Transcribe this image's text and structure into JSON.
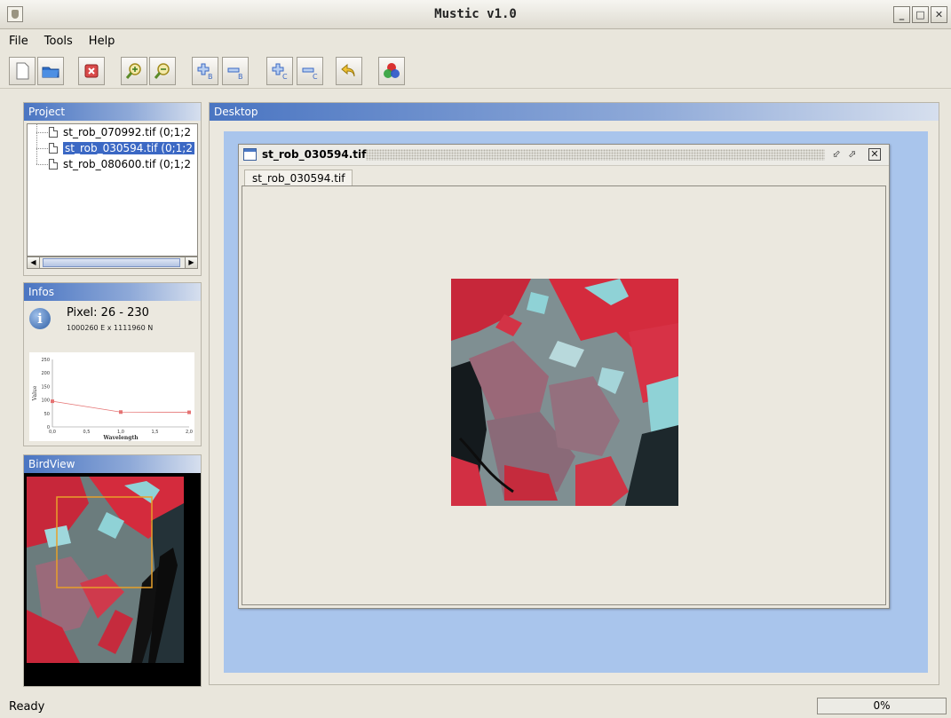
{
  "window": {
    "title": "Mustic v1.0"
  },
  "menu": [
    "File",
    "Tools",
    "Help"
  ],
  "toolbar": {
    "buttons": [
      "new-file",
      "open-folder",
      "close-file",
      "zoom-in",
      "zoom-out",
      "add-band",
      "remove-band",
      "add-class",
      "remove-class",
      "undo",
      "rgb-composite"
    ]
  },
  "project": {
    "title": "Project",
    "files": [
      {
        "label": "st_rob_070992.tif (0;1;2",
        "selected": false
      },
      {
        "label": "st_rob_030594.tif (0;1;2",
        "selected": true
      },
      {
        "label": "st_rob_080600.tif (0;1;2",
        "selected": false
      }
    ]
  },
  "infos": {
    "title": "Infos",
    "pixel": "Pixel: 26 - 230",
    "coords": "1000260 E x 1111960 N"
  },
  "chart_data": {
    "type": "line",
    "x": [
      0.0,
      1.0,
      2.0
    ],
    "values": [
      95,
      55,
      54
    ],
    "xlabel": "Wavelength",
    "ylabel": "Value",
    "xlim": [
      0.0,
      2.0
    ],
    "ylim": [
      0,
      250
    ],
    "xticks": [
      "0,0",
      "0,5",
      "1,0",
      "1,5",
      "2,0"
    ],
    "yticks": [
      "0",
      "50",
      "100",
      "150",
      "200",
      "250"
    ],
    "grid": false,
    "color": "#e57373"
  },
  "birdview": {
    "title": "BirdView",
    "frame_color": "#e8a02a"
  },
  "desktop": {
    "title": "Desktop",
    "frame_title": "st_rob_030594.tif",
    "tab_label": "st_rob_030594.tif"
  },
  "status": {
    "text": "Ready",
    "progress_label": "0%",
    "progress": 0
  },
  "colors": {
    "accent": "#3b68c4",
    "desktop_bg": "#a9c5ec",
    "image_red": "#d4283a",
    "image_cyan": "#8fd2d6"
  }
}
